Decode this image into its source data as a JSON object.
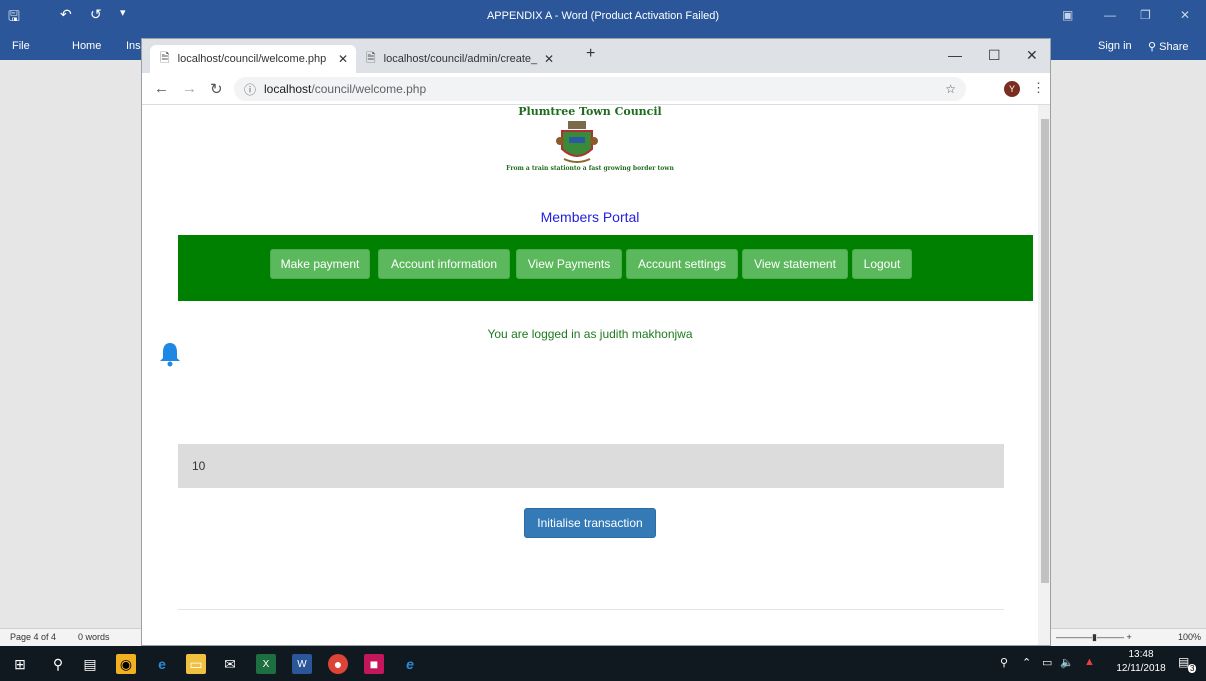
{
  "word": {
    "title": "APPENDIX A - Word (Product Activation Failed)",
    "tabs": [
      "File",
      "Home",
      "Ins"
    ],
    "sign_in": "Sign in",
    "share": "Share",
    "status_page": "Page 4 of 4",
    "status_words": "0 words",
    "zoom": "100%"
  },
  "browser": {
    "tabs": [
      {
        "label": "localhost/council/welcome.php"
      },
      {
        "label": "localhost/council/admin/create_"
      }
    ],
    "url_host": "localhost",
    "url_path": "/council/welcome.php",
    "profile_initial": "Y"
  },
  "page": {
    "council_name": "Plumtree Town Council",
    "tagline": "From a train stationto a fast growing border town",
    "portal_title": "Members Portal",
    "nav": [
      "Make payment",
      "Account information",
      "View Payments",
      "Account settings",
      "View statement",
      "Logout"
    ],
    "logged_in_text": "You are logged in as judith makhonjwa",
    "well_value": "10",
    "init_button": "Initialise transaction"
  },
  "taskbar": {
    "time": "13:48",
    "date": "12/11/2018",
    "notification_count": "3"
  },
  "colors": {
    "nav_bg": "#008000",
    "nav_button": "#5cb85c",
    "primary_button": "#337ab7",
    "word_blue": "#2b579a"
  }
}
